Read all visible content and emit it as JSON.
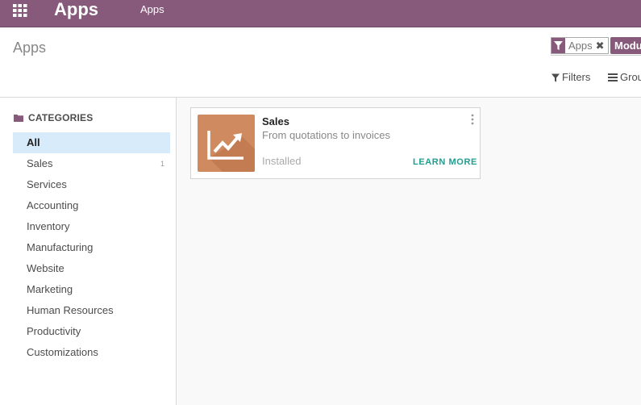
{
  "navbar": {
    "brand": "Apps",
    "menu_item": "Apps",
    "background": "#875a7b"
  },
  "control_panel": {
    "breadcrumb": "Apps",
    "search": {
      "facet_label": "Apps",
      "facet_remove_icon": "close-icon",
      "second_facet": "Modu"
    },
    "filters_label": "Filters",
    "group_label": "Grou"
  },
  "sidebar": {
    "header": "CATEGORIES",
    "items": [
      {
        "label": "All",
        "count": ""
      },
      {
        "label": "Sales",
        "count": "1"
      },
      {
        "label": "Services",
        "count": ""
      },
      {
        "label": "Accounting",
        "count": ""
      },
      {
        "label": "Inventory",
        "count": ""
      },
      {
        "label": "Manufacturing",
        "count": ""
      },
      {
        "label": "Website",
        "count": ""
      },
      {
        "label": "Marketing",
        "count": ""
      },
      {
        "label": "Human Resources",
        "count": ""
      },
      {
        "label": "Productivity",
        "count": ""
      },
      {
        "label": "Customizations",
        "count": ""
      }
    ],
    "active_index": 0,
    "active_color": "#d7ebfa"
  },
  "apps": [
    {
      "name": "Sales",
      "summary": "From quotations to invoices",
      "status": "Installed",
      "action": "LEARN MORE",
      "icon": "sales-chart-icon",
      "icon_color": "#d08a5f"
    }
  ]
}
